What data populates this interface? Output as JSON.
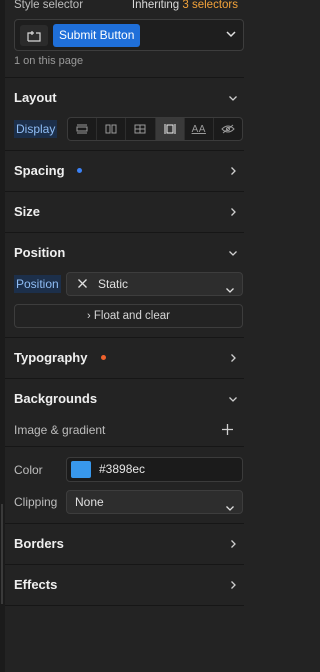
{
  "selector": {
    "label": "Style selector",
    "inheriting_prefix": "Inheriting",
    "inheriting_count": "3 selectors",
    "chip_label": "Submit Button",
    "on_page": "1 on this page"
  },
  "layout": {
    "title": "Layout",
    "display_label": "Display",
    "display_options": [
      "block-icon",
      "flex-icon",
      "grid-icon",
      "inline-block-icon",
      "inline-text-icon",
      "hidden-icon"
    ],
    "active_option": "inline-block-icon"
  },
  "spacing": {
    "title": "Spacing",
    "dot_color": "#3b82f6"
  },
  "size": {
    "title": "Size"
  },
  "position": {
    "title": "Position",
    "label": "Position",
    "value": "Static",
    "float_label": "Float and clear"
  },
  "typography": {
    "title": "Typography",
    "dot_color": "#f0622d"
  },
  "backgrounds": {
    "title": "Backgrounds",
    "image_gradient_label": "Image & gradient",
    "color_label": "Color",
    "color_hex": "#3898ec",
    "clipping_label": "Clipping",
    "clipping_value": "None"
  },
  "borders": {
    "title": "Borders"
  },
  "effects": {
    "title": "Effects"
  },
  "colors": {
    "accent": "#1f6fd9",
    "swatch": "#3898ec",
    "inherit": "#f2a23a"
  }
}
